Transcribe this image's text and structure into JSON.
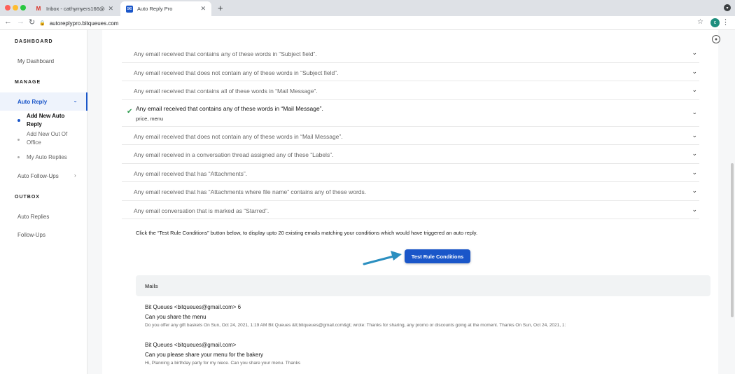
{
  "browser": {
    "tabs": [
      {
        "title": "Inbox - cathymyers166@gmail",
        "favicon": "gmail-icon"
      },
      {
        "title": "Auto Reply Pro",
        "favicon": "auto-reply-pro-icon"
      }
    ],
    "url": "autoreplypro.bitqueues.com",
    "profile_initial": "c"
  },
  "sidebar": {
    "dashboard_head": "DASHBOARD",
    "my_dashboard": "My Dashboard",
    "manage_head": "MANAGE",
    "auto_reply": "Auto Reply",
    "sub_items": [
      "Add New Auto Reply",
      "Add New Out Of Office",
      "My Auto Replies"
    ],
    "auto_followups": "Auto Follow-Ups",
    "outbox_head": "OUTBOX",
    "auto_replies": "Auto Replies",
    "follow_ups": "Follow-Ups"
  },
  "rules": [
    {
      "text": "Any email received that contains any of these words in “Subject field”.",
      "checked": false
    },
    {
      "text": "Any email received that does not contain any of these words in “Subject field”.",
      "checked": false
    },
    {
      "text": "Any email received that contains all of these words in “Mail Message”.",
      "checked": false
    },
    {
      "text": "Any email received that contains any of these words in “Mail Message”.",
      "checked": true,
      "value": "price, menu"
    },
    {
      "text": "Any email received that does not contain any of these words in “Mail Message”.",
      "checked": false
    },
    {
      "text": "Any email received in a conversation thread assigned any of these “Labels”.",
      "checked": false
    },
    {
      "text": "Any email received that has “Attachments”.",
      "checked": false
    },
    {
      "text": "Any email received that has “Attachments where file name” contains any of these words.",
      "checked": false
    },
    {
      "text": "Any email conversation that is marked as “Starred”.",
      "checked": false
    }
  ],
  "hint": "Click the “Test Rule Conditions” button below, to display upto 20 existing emails matching your conditions which would have triggered an auto reply.",
  "test_button": "Test Rule Conditions",
  "mails_head": "Mails",
  "mails": [
    {
      "from": "Bit Queues <bitqueues@gmail.com> 6",
      "subject": "Can you share the menu",
      "snippet": "Do you offer any gift baskets On Sun, Oct 24, 2021, 1:19 AM Bit Queues &lt;bitqueues@gmail.com&gt; wrote: Thanks for sharing, any promo or discounts going at the moment. Thanks On Sun, Oct 24, 2021, 1:"
    },
    {
      "from": "Bit Queues <bitqueues@gmail.com>",
      "subject": "Can you please share your menu for the bakery",
      "snippet": "Hi, Planning a birthday party for my niece. Can you share your menu. Thanks"
    }
  ],
  "colors": {
    "accent": "#1a56c9",
    "check": "#2e9b4f",
    "arrow": "#2b8fc0"
  }
}
